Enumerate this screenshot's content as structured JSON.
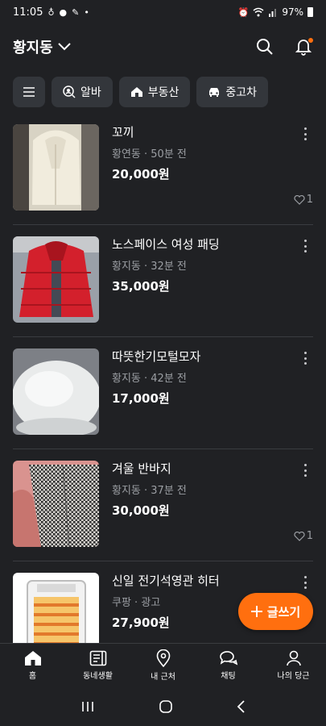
{
  "status_bar": {
    "time": "11:05",
    "battery_text": "97%",
    "left_icons": [
      "talk-icon",
      "message-icon",
      "notification-icon",
      "dot-icon"
    ],
    "right_icons": [
      "alarm-icon",
      "wifi-icon",
      "signal-icon",
      "battery-icon"
    ]
  },
  "header": {
    "location": "황지동",
    "icons": [
      "search-icon",
      "bell-icon"
    ],
    "accent": "#ff6f0f"
  },
  "chips": [
    {
      "label": "알바",
      "icon": "search-person-icon"
    },
    {
      "label": "부동산",
      "icon": "house-icon"
    },
    {
      "label": "중고차",
      "icon": "car-icon"
    }
  ],
  "items": [
    {
      "title": "꼬끼",
      "meta": "황연동 · 50분 전",
      "price": "20,000원",
      "likes": "1"
    },
    {
      "title": "노스페이스 여성 패딩",
      "meta": "황지동 · 32분 전",
      "price": "35,000원",
      "likes": ""
    },
    {
      "title": "따뜻한기모털모자",
      "meta": "황지동 · 42분 전",
      "price": "17,000원",
      "likes": ""
    },
    {
      "title": "겨울 반바지",
      "meta": "황지동 · 37분 전",
      "price": "30,000원",
      "likes": "1"
    },
    {
      "title": "신일 전기석영관 히터",
      "meta": "쿠팡 · 광고",
      "price": "27,900원",
      "likes": ""
    }
  ],
  "fab": {
    "label": "글쓰기",
    "icon": "plus-icon"
  },
  "tabs": [
    {
      "label": "홈",
      "icon": "home-icon"
    },
    {
      "label": "동네생활",
      "icon": "board-icon"
    },
    {
      "label": "내 근처",
      "icon": "location-pin-icon"
    },
    {
      "label": "채팅",
      "icon": "chat-icon"
    },
    {
      "label": "나의 당근",
      "icon": "person-icon"
    }
  ],
  "system_nav": [
    "recent-apps-icon",
    "home-circle-icon",
    "back-icon"
  ]
}
